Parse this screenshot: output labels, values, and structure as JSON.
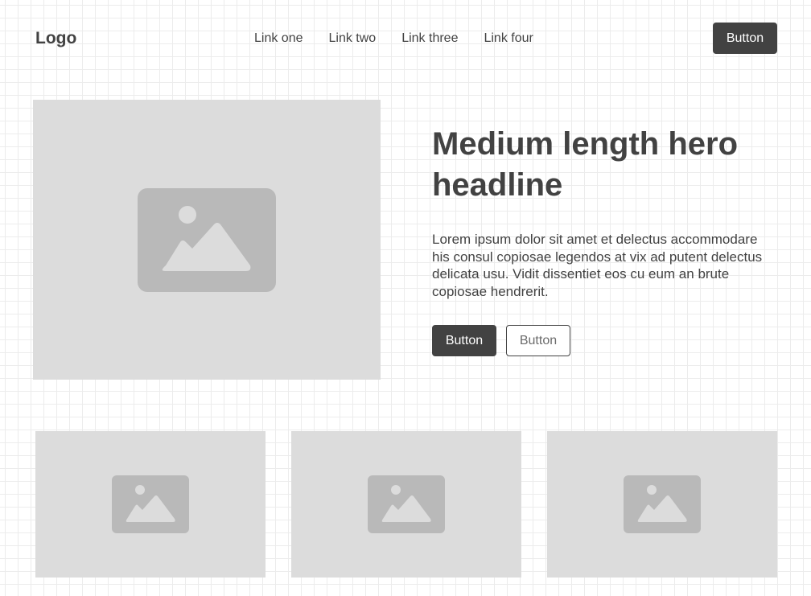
{
  "header": {
    "logo": "Logo",
    "nav": [
      "Link one",
      "Link two",
      "Link three",
      "Link four"
    ],
    "button_label": "Button"
  },
  "hero": {
    "image_icon": "image-placeholder-icon",
    "headline": "Medium length hero headline",
    "body": "Lorem ipsum dolor sit amet et delectus accommodare his consul copiosae legendos at vix ad putent delectus delicata usu. Vidit dissentiet eos cu eum an brute copiosae hendrerit.",
    "primary_button": "Button",
    "secondary_button": "Button"
  },
  "cards": [
    {
      "icon": "image-placeholder-icon"
    },
    {
      "icon": "image-placeholder-icon"
    },
    {
      "icon": "image-placeholder-icon"
    }
  ],
  "colors": {
    "dark": "#424242",
    "placeholder_bg": "#dcdcdc",
    "placeholder_icon": "#b9b9b9",
    "grid_line": "#ececec"
  }
}
